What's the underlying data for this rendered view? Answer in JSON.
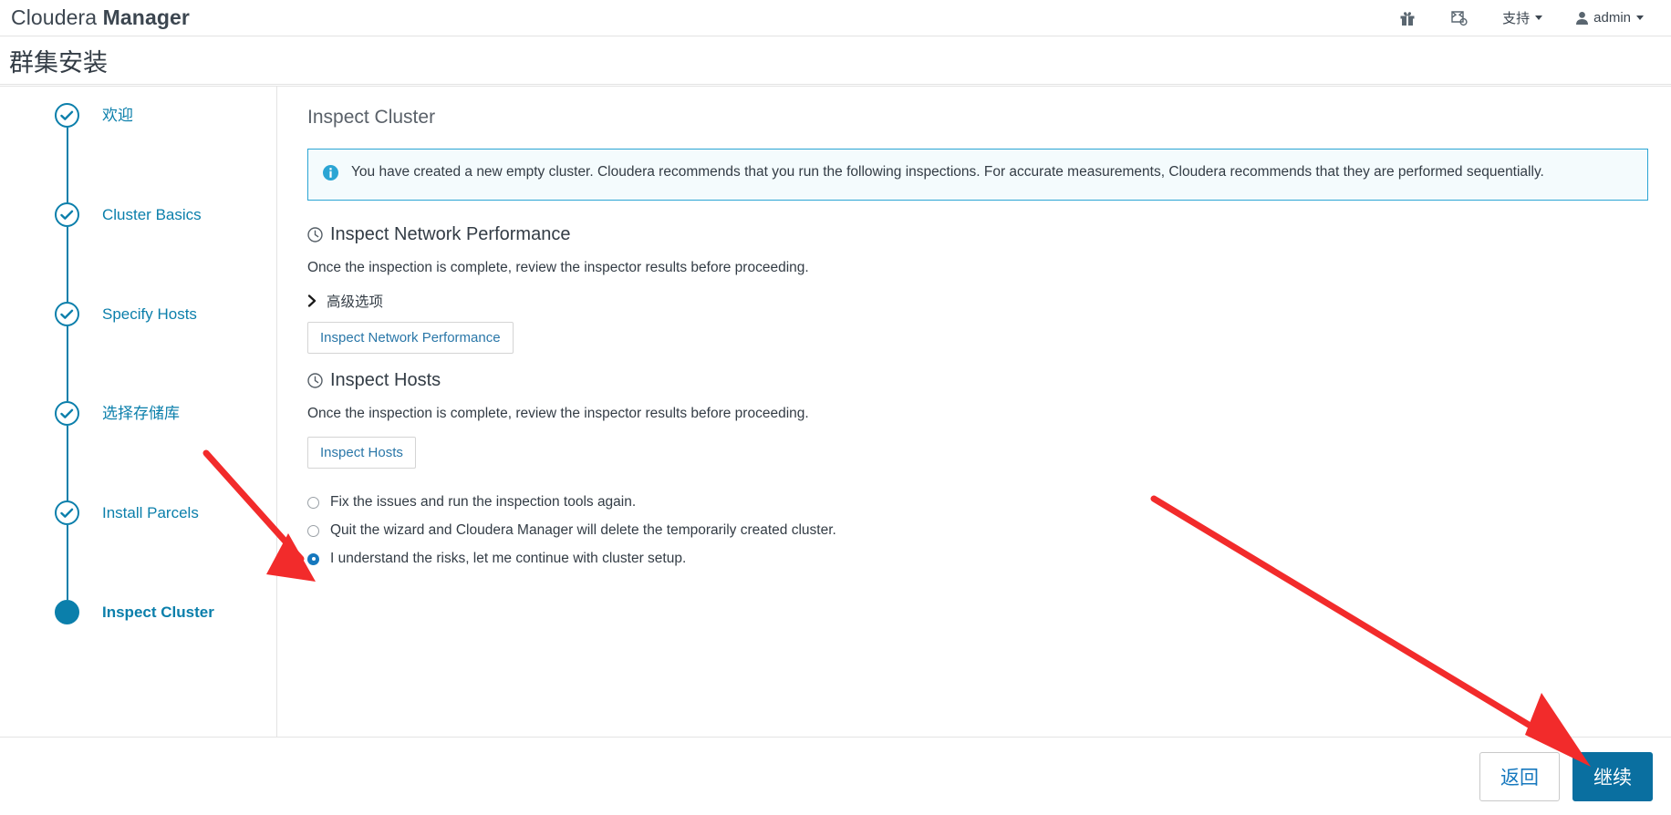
{
  "header": {
    "brand_light": "Cloudera ",
    "brand_bold": "Manager",
    "icons": [
      {
        "name": "gift-icon",
        "label": ""
      },
      {
        "name": "parcel-icon",
        "label": ""
      }
    ],
    "support_label": "支持",
    "user_label": "admin"
  },
  "page": {
    "title": "群集安装"
  },
  "sidebar": {
    "items": [
      {
        "label": "欢迎",
        "state": "done"
      },
      {
        "label": "Cluster Basics",
        "state": "done"
      },
      {
        "label": "Specify Hosts",
        "state": "done"
      },
      {
        "label": "选择存储库",
        "state": "done"
      },
      {
        "label": "Install Parcels",
        "state": "done"
      },
      {
        "label": "Inspect Cluster",
        "state": "active"
      }
    ]
  },
  "main": {
    "heading": "Inspect Cluster",
    "alert": {
      "icon": "info-icon",
      "text": "You have created a new empty cluster. Cloudera recommends that you run the following inspections. For accurate measurements, Cloudera recommends that they are performed sequentially."
    },
    "sections": [
      {
        "title": "Inspect Network Performance",
        "description": "Once the inspection is complete, review the inspector results before proceeding.",
        "advanced_label": "高级选项",
        "button_label": "Inspect Network Performance"
      },
      {
        "title": "Inspect Hosts",
        "description": "Once the inspection is complete, review the inspector results before proceeding.",
        "button_label": "Inspect Hosts"
      }
    ],
    "radios": [
      {
        "label": "Fix the issues and run the inspection tools again.",
        "checked": false
      },
      {
        "label": "Quit the wizard and Cloudera Manager will delete the temporarily created cluster.",
        "checked": false
      },
      {
        "label": "I understand the risks, let me continue with cluster setup.",
        "checked": true
      }
    ]
  },
  "footer": {
    "back_label": "返回",
    "continue_label": "继续"
  },
  "colors": {
    "accent": "#0b7fab",
    "link": "#1678be",
    "primary_button": "#0a6fa0",
    "alert_border": "#2ba5d4",
    "alert_bg": "#f4fbfd",
    "annotation": "#f22b2b"
  }
}
